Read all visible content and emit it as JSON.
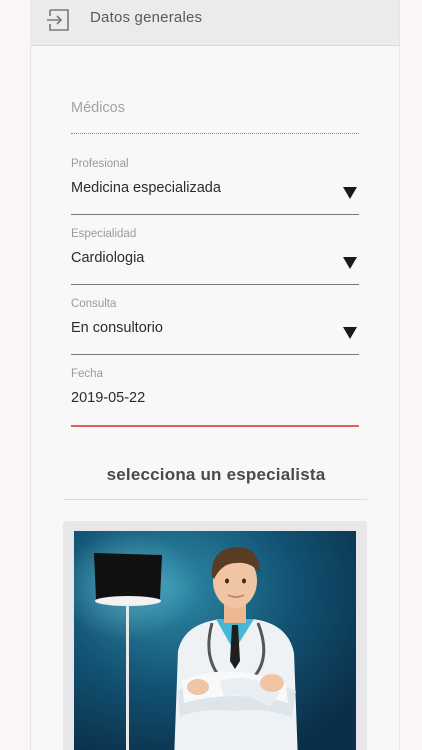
{
  "header": {
    "title": "Datos generales",
    "icon": "exit-to-app-icon"
  },
  "form": {
    "medicos_placeholder": "Médicos",
    "profesional": {
      "label": "Profesional",
      "value": "Medicina especializada"
    },
    "especialidad": {
      "label": "Especialidad",
      "value": "Cardiologia"
    },
    "consulta": {
      "label": "Consulta",
      "value": "En consultorio"
    },
    "fecha": {
      "label": "Fecha",
      "value": "2019-05-22"
    }
  },
  "specialists": {
    "title": "selecciona un especialista",
    "card_image": "doctor-illustration"
  },
  "colors": {
    "active_underline": "#e0615a",
    "header_bg": "#ebebed",
    "card_image_bg": "#0d3f5a"
  }
}
